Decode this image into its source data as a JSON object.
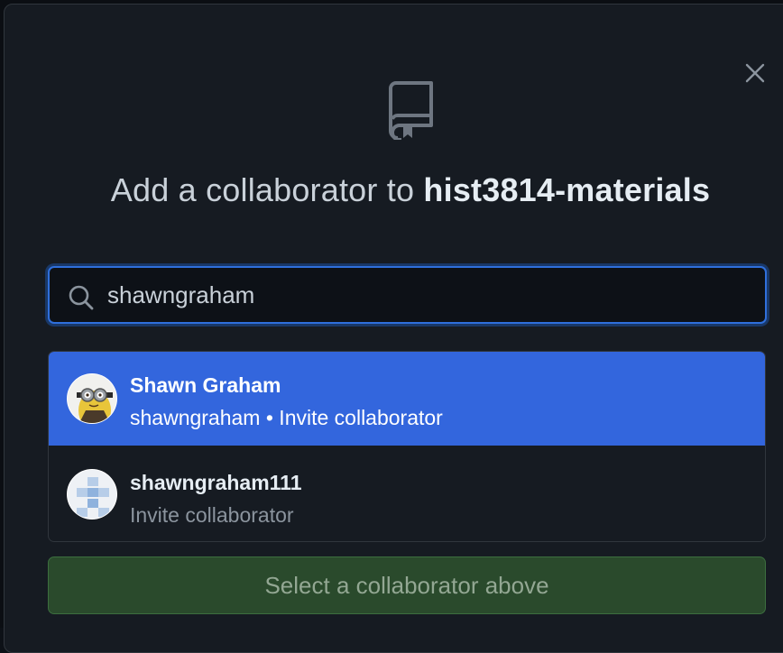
{
  "dialog": {
    "title_prefix": "Add a collaborator to ",
    "repo_name": "hist3814-materials",
    "close_icon": "close-icon",
    "repo_icon": "repo-icon"
  },
  "search": {
    "value": "shawngraham",
    "icon": "search-icon"
  },
  "results": [
    {
      "name": "Shawn Graham",
      "subtitle": "shawngraham • Invite collaborator",
      "selected": true
    },
    {
      "name": "shawngraham111",
      "subtitle": "Invite collaborator",
      "selected": false
    }
  ],
  "action": {
    "label": "Select a collaborator above",
    "enabled": false
  },
  "colors": {
    "accent": "#3366dd",
    "focus_border": "#2f6fdc",
    "button_bg": "#2a4a2c"
  }
}
